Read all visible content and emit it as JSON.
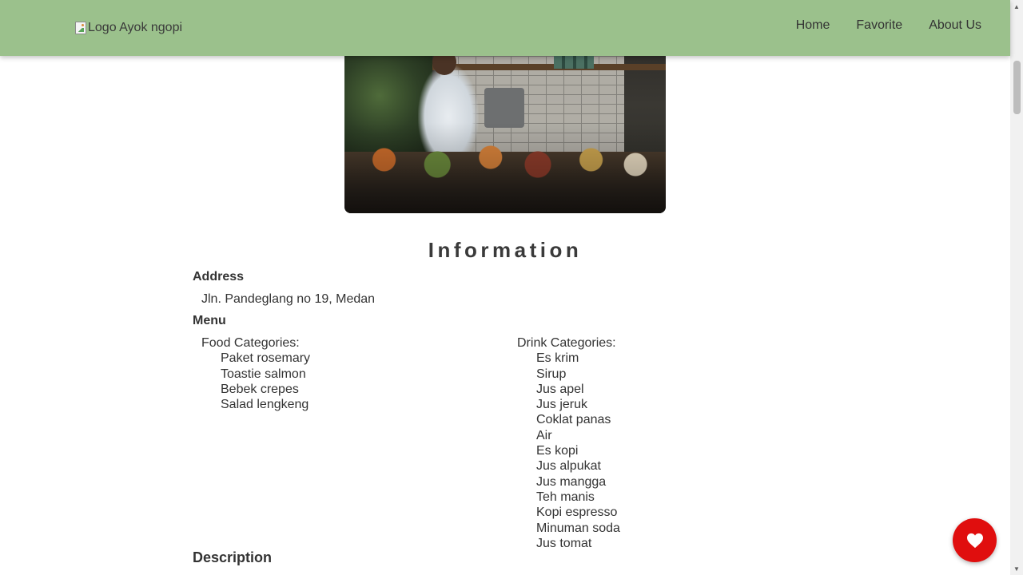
{
  "navbar": {
    "logo_alt": "Logo Ayok ngopi",
    "links": [
      {
        "label": "Home"
      },
      {
        "label": "Favorite"
      },
      {
        "label": "About Us"
      }
    ]
  },
  "info": {
    "title": "Information",
    "address_label": "Address",
    "address": "Jln. Pandeglang no 19, Medan",
    "menu_label": "Menu",
    "food": {
      "heading": "Food Categories:",
      "items": [
        "Paket rosemary",
        "Toastie salmon",
        "Bebek crepes",
        "Salad lengkeng"
      ]
    },
    "drink": {
      "heading": "Drink Categories:",
      "items": [
        "Es krim",
        "Sirup",
        "Jus apel",
        "Jus jeruk",
        "Coklat panas",
        "Air",
        "Es kopi",
        "Jus alpukat",
        "Jus mangga",
        "Teh manis",
        "Kopi espresso",
        "Minuman soda",
        "Jus tomat"
      ]
    },
    "description_label": "Description"
  },
  "favorite_button": {
    "icon": "heart-icon",
    "color": "#e00e0e"
  },
  "colors": {
    "navbar": "#9bc18c",
    "text": "#333333"
  }
}
